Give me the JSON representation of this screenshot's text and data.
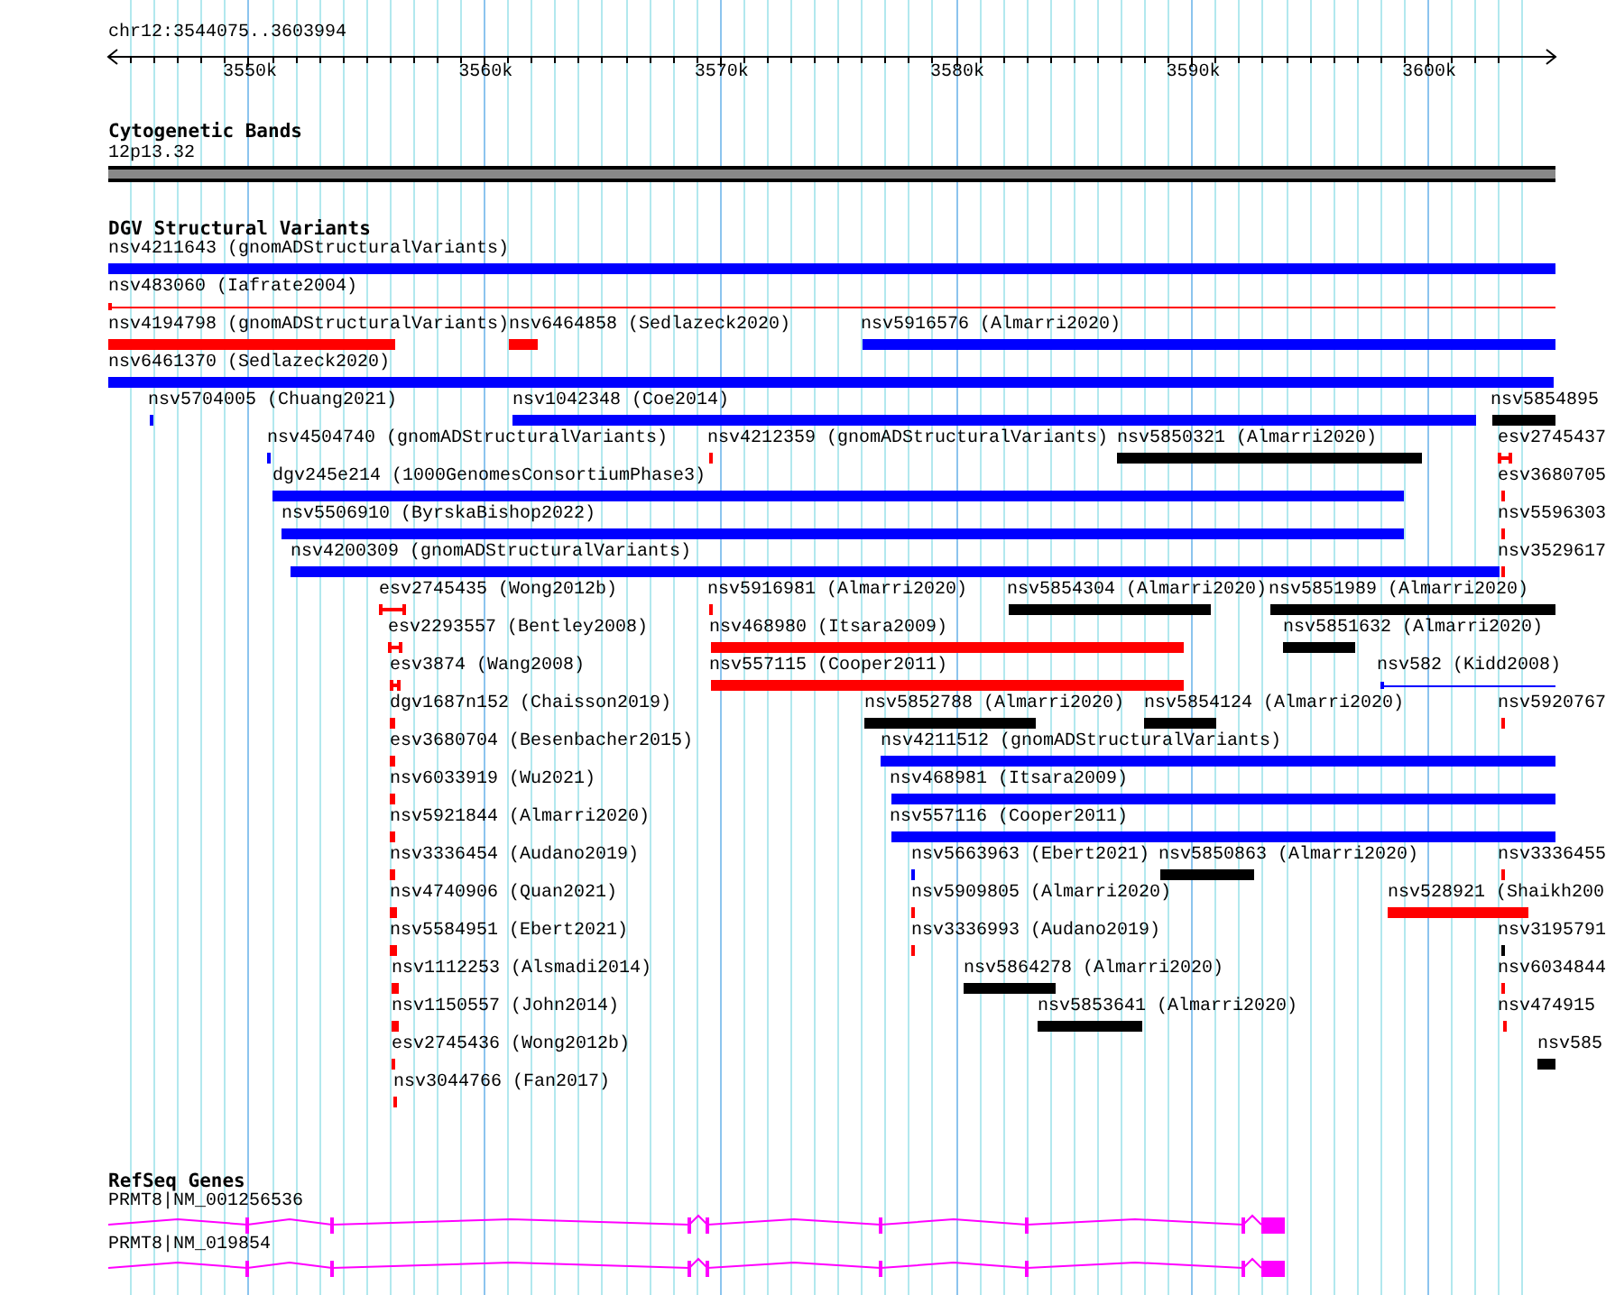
{
  "ruler": {
    "region": "chr12:3544075..3603994",
    "ticks": [
      "3550k",
      "3560k",
      "3570k",
      "3580k",
      "3590k",
      "3600k"
    ]
  },
  "cytogenetic_bands": {
    "title": "Cytogenetic Bands",
    "band": "12p13.32"
  },
  "dgv": {
    "title": "DGV Structural Variants",
    "features": [
      {
        "label": "nsv4211643 (gnomADStructuralVariants)",
        "color": "#0000ff",
        "kind": "bar"
      },
      {
        "label": "nsv483060 (Iafrate2004)",
        "color": "#ff0000",
        "kind": "line"
      },
      {
        "label": "nsv4194798 (gnomADStructuralVariants)",
        "color": "#ff0000",
        "kind": "bar"
      },
      {
        "label": "nsv6464858 (Sedlazeck2020)",
        "color": "#ff0000",
        "kind": "bar"
      },
      {
        "label": "nsv5916576 (Almarri2020)",
        "color": "#0000ff",
        "kind": "bar"
      },
      {
        "label": "nsv6461370 (Sedlazeck2020)",
        "color": "#0000ff",
        "kind": "bar"
      },
      {
        "label": "nsv5704005 (Chuang2021)",
        "color": "#0000ff",
        "kind": "bar"
      },
      {
        "label": "nsv1042348 (Coe2014)",
        "color": "#0000ff",
        "kind": "bar"
      },
      {
        "label": "nsv5854895",
        "color": "#000000",
        "kind": "bar"
      },
      {
        "label": "nsv4504740 (gnomADStructuralVariants)",
        "color": "#0000ff",
        "kind": "bar"
      },
      {
        "label": "nsv4212359 (gnomADStructuralVariants)",
        "color": "#ff0000",
        "kind": "bar"
      },
      {
        "label": "nsv5850321 (Almarri2020)",
        "color": "#000000",
        "kind": "bar"
      },
      {
        "label": "esv2745437",
        "color": "#ff0000",
        "kind": "span"
      },
      {
        "label": "dgv245e214 (1000GenomesConsortiumPhase3)",
        "color": "#0000ff",
        "kind": "bar"
      },
      {
        "label": "esv3680705",
        "color": "#ff0000",
        "kind": "bar"
      },
      {
        "label": "nsv5506910 (ByrskaBishop2022)",
        "color": "#0000ff",
        "kind": "bar"
      },
      {
        "label": "nsv5596303",
        "color": "#ff0000",
        "kind": "bar"
      },
      {
        "label": "nsv4200309 (gnomADStructuralVariants)",
        "color": "#0000ff",
        "kind": "bar"
      },
      {
        "label": "nsv3529617",
        "color": "#ff0000",
        "kind": "bar"
      },
      {
        "label": "esv2745435 (Wong2012b)",
        "color": "#ff0000",
        "kind": "span"
      },
      {
        "label": "nsv5916981 (Almarri2020)",
        "color": "#ff0000",
        "kind": "bar"
      },
      {
        "label": "nsv5854304 (Almarri2020)",
        "color": "#000000",
        "kind": "bar"
      },
      {
        "label": "nsv5851989 (Almarri2020)",
        "color": "#000000",
        "kind": "bar"
      },
      {
        "label": "esv2293557 (Bentley2008)",
        "color": "#ff0000",
        "kind": "span"
      },
      {
        "label": "nsv468980 (Itsara2009)",
        "color": "#ff0000",
        "kind": "bar"
      },
      {
        "label": "nsv5851632 (Almarri2020)",
        "color": "#000000",
        "kind": "bar"
      },
      {
        "label": "esv3874 (Wang2008)",
        "color": "#ff0000",
        "kind": "span"
      },
      {
        "label": "nsv557115 (Cooper2011)",
        "color": "#ff0000",
        "kind": "bar"
      },
      {
        "label": "nsv582 (Kidd2008)",
        "color": "#0000ff",
        "kind": "line"
      },
      {
        "label": "dgv1687n152 (Chaisson2019)",
        "color": "#ff0000",
        "kind": "bar"
      },
      {
        "label": "nsv5852788 (Almarri2020)",
        "color": "#000000",
        "kind": "bar"
      },
      {
        "label": "nsv5854124 (Almarri2020)",
        "color": "#000000",
        "kind": "bar"
      },
      {
        "label": "nsv5920767",
        "color": "#ff0000",
        "kind": "bar"
      },
      {
        "label": "esv3680704 (Besenbacher2015)",
        "color": "#ff0000",
        "kind": "bar"
      },
      {
        "label": "nsv4211512 (gnomADStructuralVariants)",
        "color": "#0000ff",
        "kind": "bar"
      },
      {
        "label": "nsv6033919 (Wu2021)",
        "color": "#ff0000",
        "kind": "bar"
      },
      {
        "label": "nsv468981 (Itsara2009)",
        "color": "#0000ff",
        "kind": "bar"
      },
      {
        "label": "nsv5921844 (Almarri2020)",
        "color": "#ff0000",
        "kind": "bar"
      },
      {
        "label": "nsv557116 (Cooper2011)",
        "color": "#0000ff",
        "kind": "bar"
      },
      {
        "label": "nsv3336454 (Audano2019)",
        "color": "#ff0000",
        "kind": "bar"
      },
      {
        "label": "nsv5663963 (Ebert2021)",
        "color": "#0000ff",
        "kind": "bar"
      },
      {
        "label": "nsv5850863 (Almarri2020)",
        "color": "#000000",
        "kind": "bar"
      },
      {
        "label": "nsv3336455",
        "color": "#ff0000",
        "kind": "bar"
      },
      {
        "label": "nsv4740906 (Quan2021)",
        "color": "#ff0000",
        "kind": "bar"
      },
      {
        "label": "nsv5909805 (Almarri2020)",
        "color": "#ff0000",
        "kind": "bar"
      },
      {
        "label": "nsv528921 (Shaikh200",
        "color": "#ff0000",
        "kind": "bar"
      },
      {
        "label": "nsv5584951 (Ebert2021)",
        "color": "#ff0000",
        "kind": "bar"
      },
      {
        "label": "nsv3336993 (Audano2019)",
        "color": "#ff0000",
        "kind": "bar"
      },
      {
        "label": "nsv3195791",
        "color": "#000000",
        "kind": "bar"
      },
      {
        "label": "nsv1112253 (Alsmadi2014)",
        "color": "#ff0000",
        "kind": "bar"
      },
      {
        "label": "nsv5864278 (Almarri2020)",
        "color": "#000000",
        "kind": "bar"
      },
      {
        "label": "nsv6034844",
        "color": "#ff0000",
        "kind": "bar"
      },
      {
        "label": "nsv1150557 (John2014)",
        "color": "#ff0000",
        "kind": "bar"
      },
      {
        "label": "nsv5853641 (Almarri2020)",
        "color": "#000000",
        "kind": "bar"
      },
      {
        "label": "nsv474915",
        "color": "#ff0000",
        "kind": "bar"
      },
      {
        "label": "esv2745436 (Wong2012b)",
        "color": "#ff0000",
        "kind": "bar"
      },
      {
        "label": "nsv585",
        "color": "#000000",
        "kind": "bar"
      },
      {
        "label": "nsv3044766 (Fan2017)",
        "color": "#ff0000",
        "kind": "bar"
      }
    ]
  },
  "refseq_genes": {
    "title": "RefSeq Genes",
    "genes": [
      {
        "label": "PRMT8|NM_001256536"
      },
      {
        "label": "PRMT8|NM_019854"
      }
    ]
  }
}
